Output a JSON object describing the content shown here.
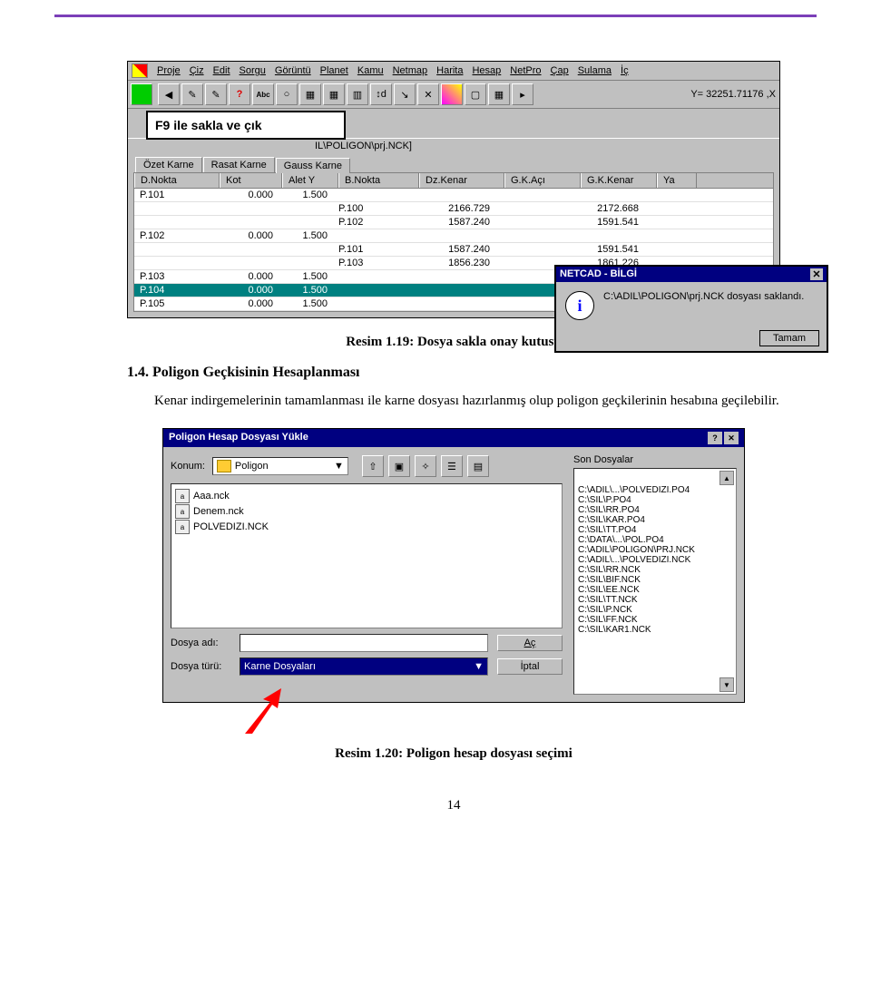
{
  "page_number": "14",
  "figure1": {
    "menu": [
      "Proje",
      "Çiz",
      "Edit",
      "Sorgu",
      "Görüntü",
      "Planet",
      "Kamu",
      "Netmap",
      "Harita",
      "Hesap",
      "NetPro",
      "Çap",
      "Sulama",
      "İç"
    ],
    "status_right": "Y= 32251.71176 ,X",
    "f9_label": "F9 ile sakla ve çık",
    "title_path": "IL\\POLIGON\\prj.NCK]",
    "tabs": [
      "Özet Karne",
      "Rasat Karne",
      "Gauss Karne"
    ],
    "active_tab": 2,
    "grid_headers": [
      "D.Nokta",
      "Kot",
      "Alet Y",
      "B.Nokta",
      "Dz.Kenar",
      "G.K.Açı",
      "G.K.Kenar",
      "Ya"
    ],
    "rows": [
      {
        "d": "P.101",
        "kot": "0.000",
        "alet": "1.500",
        "b": "",
        "dz": "",
        "gk": "",
        "gkk": ""
      },
      {
        "d": "",
        "kot": "",
        "alet": "",
        "b": "P.100",
        "dz": "2166.729",
        "gk": "",
        "gkk": "2172.668"
      },
      {
        "d": "",
        "kot": "",
        "alet": "",
        "b": "P.102",
        "dz": "1587.240",
        "gk": "",
        "gkk": "1591.541"
      },
      {
        "d": "P.102",
        "kot": "0.000",
        "alet": "1.500",
        "b": "",
        "dz": "",
        "gk": "",
        "gkk": ""
      },
      {
        "d": "",
        "kot": "",
        "alet": "",
        "b": "P.101",
        "dz": "1587.240",
        "gk": "",
        "gkk": "1591.541"
      },
      {
        "d": "",
        "kot": "",
        "alet": "",
        "b": "P.103",
        "dz": "1856.230",
        "gk": "",
        "gkk": "1861.226"
      },
      {
        "d": "P.103",
        "kot": "0.000",
        "alet": "1.500",
        "b": "",
        "dz": "",
        "gk": "",
        "gkk": ""
      },
      {
        "d": "P.104",
        "kot": "0.000",
        "alet": "1.500",
        "b": "",
        "dz": "",
        "gk": "",
        "gkk": "",
        "sel": true
      },
      {
        "d": "P.105",
        "kot": "0.000",
        "alet": "1.500",
        "b": "",
        "dz": "",
        "gk": "",
        "gkk": ""
      }
    ],
    "msg": {
      "title": "NETCAD - BİLGİ",
      "text": "C:\\ADIL\\POLIGON\\prj.NCK dosyası saklandı.",
      "ok": "Tamam"
    },
    "toolbar_abc": "Abc"
  },
  "caption1": "Resim 1.19: Dosya sakla onay kutusu",
  "section_title": "1.4. Poligon Geçkisinin Hesaplanması",
  "body_text": "Kenar indirgemelerinin tamamlanması ile karne dosyası hazırlanmış olup poligon geçkilerinin hesabına geçilebilir.",
  "figure2": {
    "title": "Poligon Hesap Dosyası Yükle",
    "konum_label": "Konum:",
    "folder": "Poligon",
    "files": [
      "Aaa.nck",
      "Denem.nck",
      "POLVEDIZI.NCK"
    ],
    "dosya_adi_label": "Dosya adı:",
    "dosya_adi_value": "",
    "dosya_turu_label": "Dosya türü:",
    "dosya_turu_value": "Karne Dosyaları",
    "btn_open": "Aç",
    "btn_cancel": "İptal",
    "son_dosyalar_label": "Son Dosyalar",
    "recent": [
      "C:\\ADIL\\...\\POLVEDIZI.PO4",
      "C:\\SIL\\P.PO4",
      "C:\\SIL\\RR.PO4",
      "C:\\SIL\\KAR.PO4",
      "C:\\SIL\\TT.PO4",
      "C:\\DATA\\...\\POL.PO4",
      "C:\\ADIL\\POLIGON\\PRJ.NCK",
      "C:\\ADIL\\...\\POLVEDIZI.NCK",
      "C:\\SIL\\RR.NCK",
      "C:\\SIL\\BIF.NCK",
      "C:\\SIL\\EE.NCK",
      "C:\\SIL\\TT.NCK",
      "C:\\SIL\\P.NCK",
      "C:\\SIL\\FF.NCK",
      "C:\\SIL\\KAR1.NCK"
    ]
  },
  "caption2": "Resim 1.20: Poligon hesap dosyası seçimi"
}
